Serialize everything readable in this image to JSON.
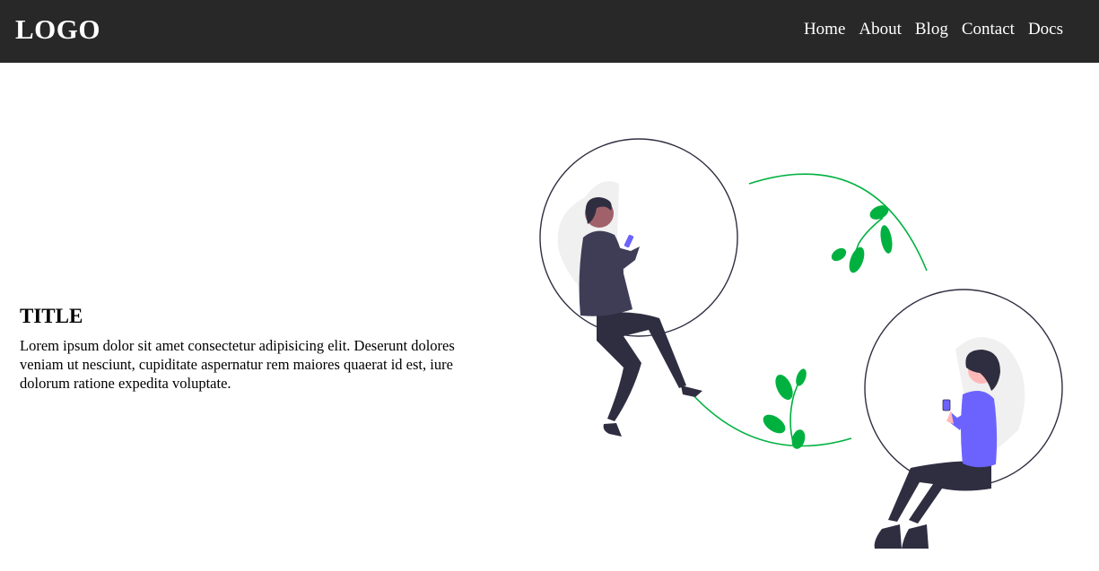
{
  "navbar": {
    "logo": "LOGO",
    "links": [
      "Home",
      "About",
      "Blog",
      "Contact",
      "Docs"
    ]
  },
  "hero": {
    "title": "TITLE",
    "description": "Lorem ipsum dolor sit amet consectetur adipisicing elit. Deserunt dolores veniam ut nesciunt, cupiditate aspernatur rem maiores quaerat id est, iure dolorum ratione expedita voluptate."
  },
  "colors": {
    "navbar_bg": "#282828",
    "accent_green": "#00b140",
    "accent_purple": "#6c63ff",
    "dark_figure": "#2f2e41"
  }
}
